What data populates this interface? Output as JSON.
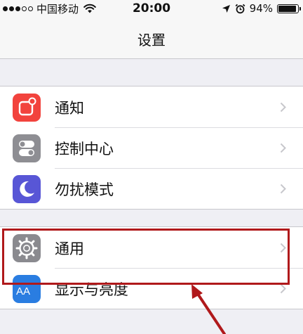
{
  "status_bar": {
    "carrier": "中国移动",
    "time": "20:00",
    "battery": "94%",
    "signal_bars": 3,
    "signal_bars_max": 5,
    "battery_level": 0.94
  },
  "nav": {
    "title": "设置"
  },
  "groups": [
    {
      "items": [
        {
          "label": "通知",
          "icon": "notifications-icon",
          "color": "#f2433d"
        },
        {
          "label": "控制中心",
          "icon": "control-center-icon",
          "color": "#8e8e93"
        },
        {
          "label": "勿扰模式",
          "icon": "do-not-disturb-moon-icon",
          "color": "#5856d6"
        }
      ]
    },
    {
      "items": [
        {
          "label": "通用",
          "icon": "general-gear-icon",
          "color": "#8a8a8f"
        },
        {
          "label": "显示与亮度",
          "icon": "display-brightness-aa-icon",
          "color": "#2a7de1"
        }
      ]
    }
  ],
  "icon_text": {
    "display_brightness": "AA"
  },
  "annotation": {
    "highlight_color": "#b0191b",
    "arrow_color": "#b0191b"
  }
}
